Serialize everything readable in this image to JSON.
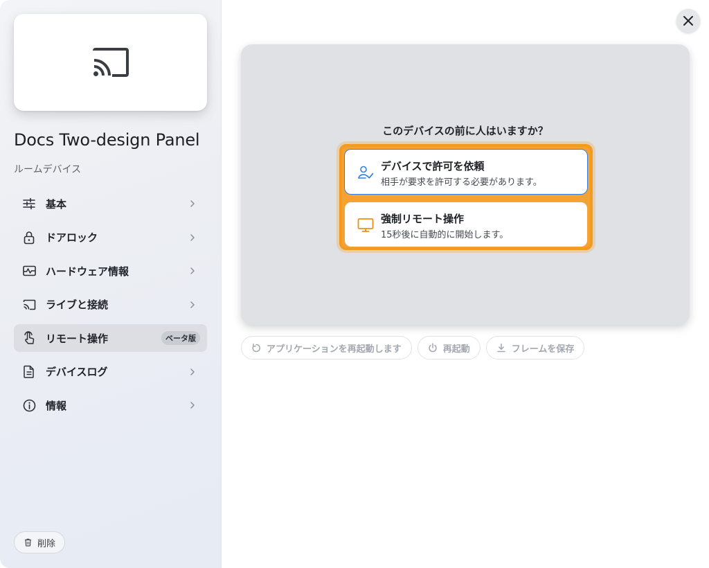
{
  "device": {
    "name": "Docs Two-design Panel",
    "type": "ルームデバイス",
    "icon": "cast-icon"
  },
  "sidebar": {
    "items": [
      {
        "label": "基本",
        "icon": "sliders-icon"
      },
      {
        "label": "ドアロック",
        "icon": "lock-icon"
      },
      {
        "label": "ハードウェア情報",
        "icon": "pulse-monitor-icon"
      },
      {
        "label": "ライブと接続",
        "icon": "cast-icon"
      },
      {
        "label": "リモート操作",
        "icon": "touch-hand-icon",
        "badge": "ベータ版",
        "active": true
      },
      {
        "label": "デバイスログ",
        "icon": "document-icon"
      },
      {
        "label": "情報",
        "icon": "info-icon"
      }
    ],
    "delete_label": "削除"
  },
  "remote": {
    "question": "このデバイスの前に人はいますか？",
    "options": [
      {
        "title": "デバイスで許可を依頼",
        "desc": "相手が要求を許可する必要があります。",
        "icon": "user-check-icon"
      },
      {
        "title": "強制リモート操作",
        "desc": "15秒後に自動的に開始します。",
        "icon": "monitor-icon"
      }
    ]
  },
  "actions": [
    {
      "label": "アプリケーションを再起動します",
      "icon": "restart-icon"
    },
    {
      "label": "再起動",
      "icon": "power-icon"
    },
    {
      "label": "フレームを保存",
      "icon": "download-icon"
    }
  ],
  "colors": {
    "accent_orange": "#f29b1f",
    "accent_blue": "#2f7fe0",
    "active_nav_bg": "#dcdee3"
  }
}
